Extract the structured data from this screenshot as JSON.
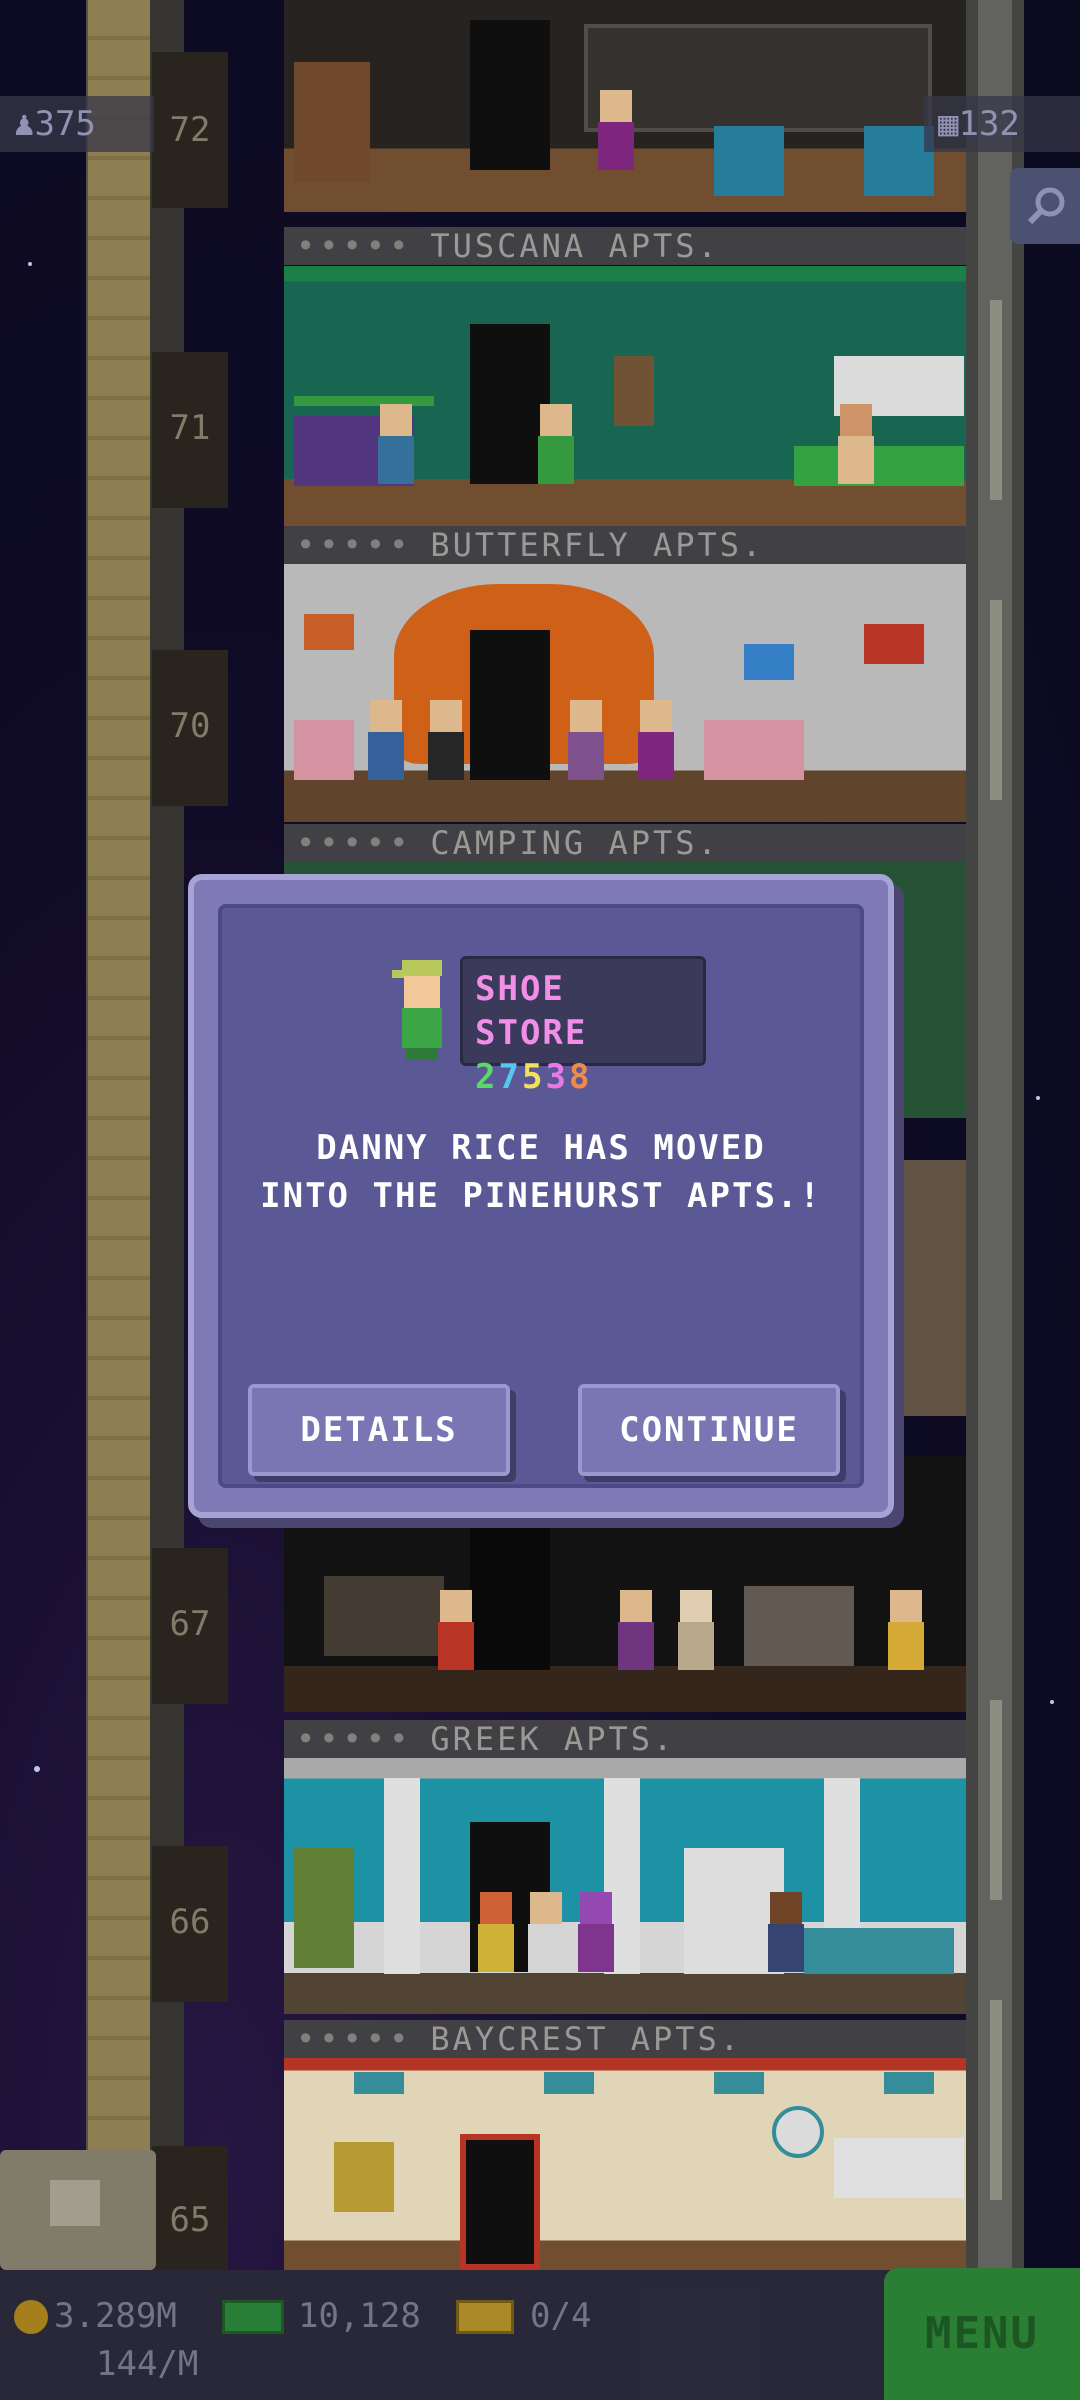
{
  "hud": {
    "population": "375",
    "floors": "132"
  },
  "floors": [
    {
      "number": "72",
      "banner": "TUSCANA APTS."
    },
    {
      "number": "71",
      "banner": "BUTTERFLY APTS."
    },
    {
      "number": "70",
      "banner": "CAMPING APTS."
    },
    {
      "number": "67",
      "banner": "GREEK APTS."
    },
    {
      "number": "66",
      "banner": "BAYCREST APTS."
    },
    {
      "number": "65",
      "banner": ""
    }
  ],
  "banner_dots": "•••••",
  "dialog": {
    "store_name": "SHOE STORE",
    "store_digits": [
      {
        "d": "2",
        "color": "#5ad86a"
      },
      {
        "d": "7",
        "color": "#56c8f0"
      },
      {
        "d": "5",
        "color": "#f2e25a"
      },
      {
        "d": "3",
        "color": "#e87ae8"
      },
      {
        "d": "8",
        "color": "#f08a4a"
      }
    ],
    "message_line1": "DANNY RICE HAS MOVED",
    "message_line2": "INTO THE PINEHURST APTS.!",
    "details_label": "DETAILS",
    "continue_label": "CONTINUE"
  },
  "bottom_bar": {
    "coins": "3.289M",
    "coins_rate": "144/M",
    "bux": "10,128",
    "tickets": "0/4",
    "menu_label": "MENU"
  },
  "colors": {
    "menu_green": "#2e8a3a",
    "dialog_bg": "#5b5896",
    "store_name": "#f08ee8"
  }
}
